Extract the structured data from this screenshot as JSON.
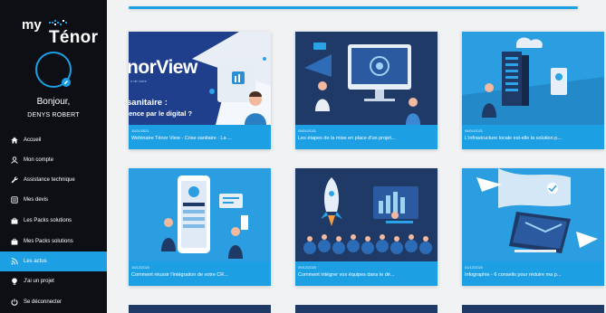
{
  "brand": {
    "my": "my",
    "name": "Ténor"
  },
  "user": {
    "greeting": "Bonjour,",
    "name": "DENYS ROBERT"
  },
  "nav": [
    {
      "label": "Accueil",
      "icon": "home-icon"
    },
    {
      "label": "Mon compte",
      "icon": "user-icon"
    },
    {
      "label": "Assistance technique",
      "icon": "wrench-icon"
    },
    {
      "label": "Mes devis",
      "icon": "document-icon"
    },
    {
      "label": "Les Packs solutions",
      "icon": "bag-icon"
    },
    {
      "label": "Mes Packs solutions",
      "icon": "bag-icon"
    },
    {
      "label": "Les actus",
      "icon": "rss-icon",
      "active": true
    },
    {
      "label": "J'ai un projet",
      "icon": "bulb-icon"
    },
    {
      "label": "Se déconnecter",
      "icon": "power-icon"
    }
  ],
  "cards": [
    {
      "date": "11/01/2021",
      "title": "Webinaire Ténor View - Crise sanitaire : La ...",
      "thumb": {
        "logo_text": "norView",
        "headline": "sanitaire :",
        "subline": "ience par le digital ?",
        "tagline": "n de votre"
      }
    },
    {
      "date": "05/01/2021",
      "title": "Les étapes de la mise en place d'un projet..."
    },
    {
      "date": "05/01/2021",
      "title": "L'infrastructure locale est-elle la solution p..."
    },
    {
      "date": "15/12/2020",
      "title": "Comment réussir l'intégration de votre CR..."
    },
    {
      "date": "09/12/2020",
      "title": "Comment intégrer vos équipes dans le dé..."
    },
    {
      "date": "01/12/2020",
      "title": "Infographie - 6 conseils pour réduire ma p..."
    }
  ],
  "colors": {
    "accent": "#1d9fe4",
    "sidebar": "#0d0f14",
    "navy": "#1f3a66",
    "background": "#f1f2f4"
  }
}
